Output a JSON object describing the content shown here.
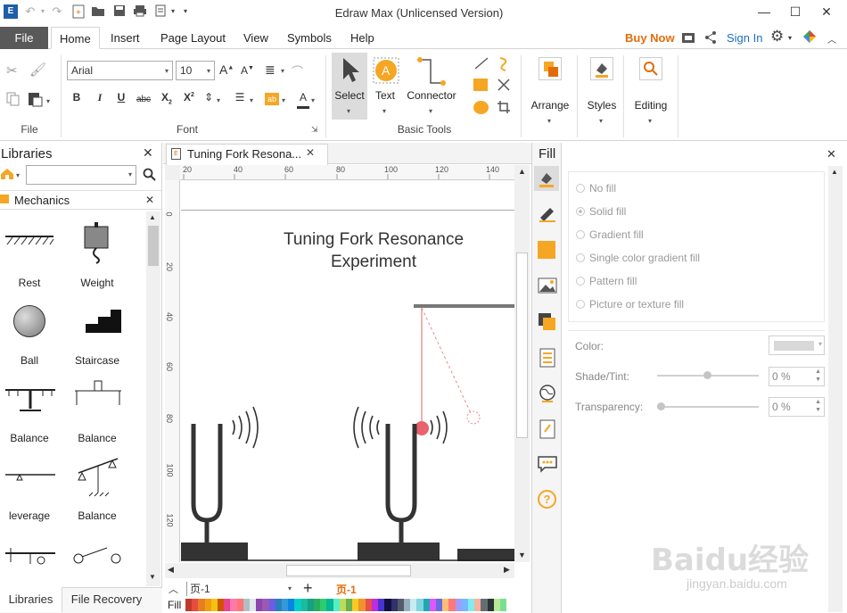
{
  "app": {
    "title": "Edraw Max (Unlicensed Version)"
  },
  "menu": {
    "file": "File",
    "tabs": [
      "Home",
      "Insert",
      "Page Layout",
      "View",
      "Symbols",
      "Help"
    ],
    "buy_now": "Buy Now",
    "sign_in": "Sign In"
  },
  "ribbon": {
    "file_group": "File",
    "font_group": "Font",
    "font_name": "Arial",
    "font_size": "10",
    "basic_tools_group": "Basic Tools",
    "select": "Select",
    "text": "Text",
    "connector": "Connector",
    "arrange": "Arrange",
    "styles": "Styles",
    "editing": "Editing"
  },
  "libraries": {
    "title": "Libraries",
    "category": "Mechanics",
    "items": [
      "Rest",
      "Weight",
      "Ball",
      "Staircase",
      "Balance",
      "Balance",
      "leverage",
      "Balance"
    ],
    "bottom_tabs": [
      "Libraries",
      "File Recovery"
    ]
  },
  "document": {
    "tab_title": "Tuning Fork Resona...",
    "canvas_title_line1": "Tuning Fork Resonance",
    "canvas_title_line2": "Experiment",
    "ruler_h": [
      "20",
      "40",
      "60",
      "80",
      "100",
      "120",
      "140"
    ],
    "ruler_v": [
      "0",
      "20",
      "40",
      "60",
      "80",
      "100",
      "120"
    ],
    "page_tab": "页-1",
    "page_tab_active": "页-1",
    "fill_label": "Fill"
  },
  "fill_panel": {
    "title": "Fill",
    "options": [
      "No fill",
      "Solid fill",
      "Gradient fill",
      "Single color gradient fill",
      "Pattern fill",
      "Picture or texture fill"
    ],
    "color_label": "Color:",
    "shade_label": "Shade/Tint:",
    "shade_value": "0 %",
    "transparency_label": "Transparency:",
    "transparency_value": "0 %"
  },
  "colors": {
    "accent_orange": "#f5a623",
    "buy_now": "#e36c09",
    "sign_in": "#1e6fc2",
    "file_bg": "#595959"
  },
  "watermark": {
    "text1": "Baidu经验",
    "text2": "jingyan.baidu.com"
  }
}
